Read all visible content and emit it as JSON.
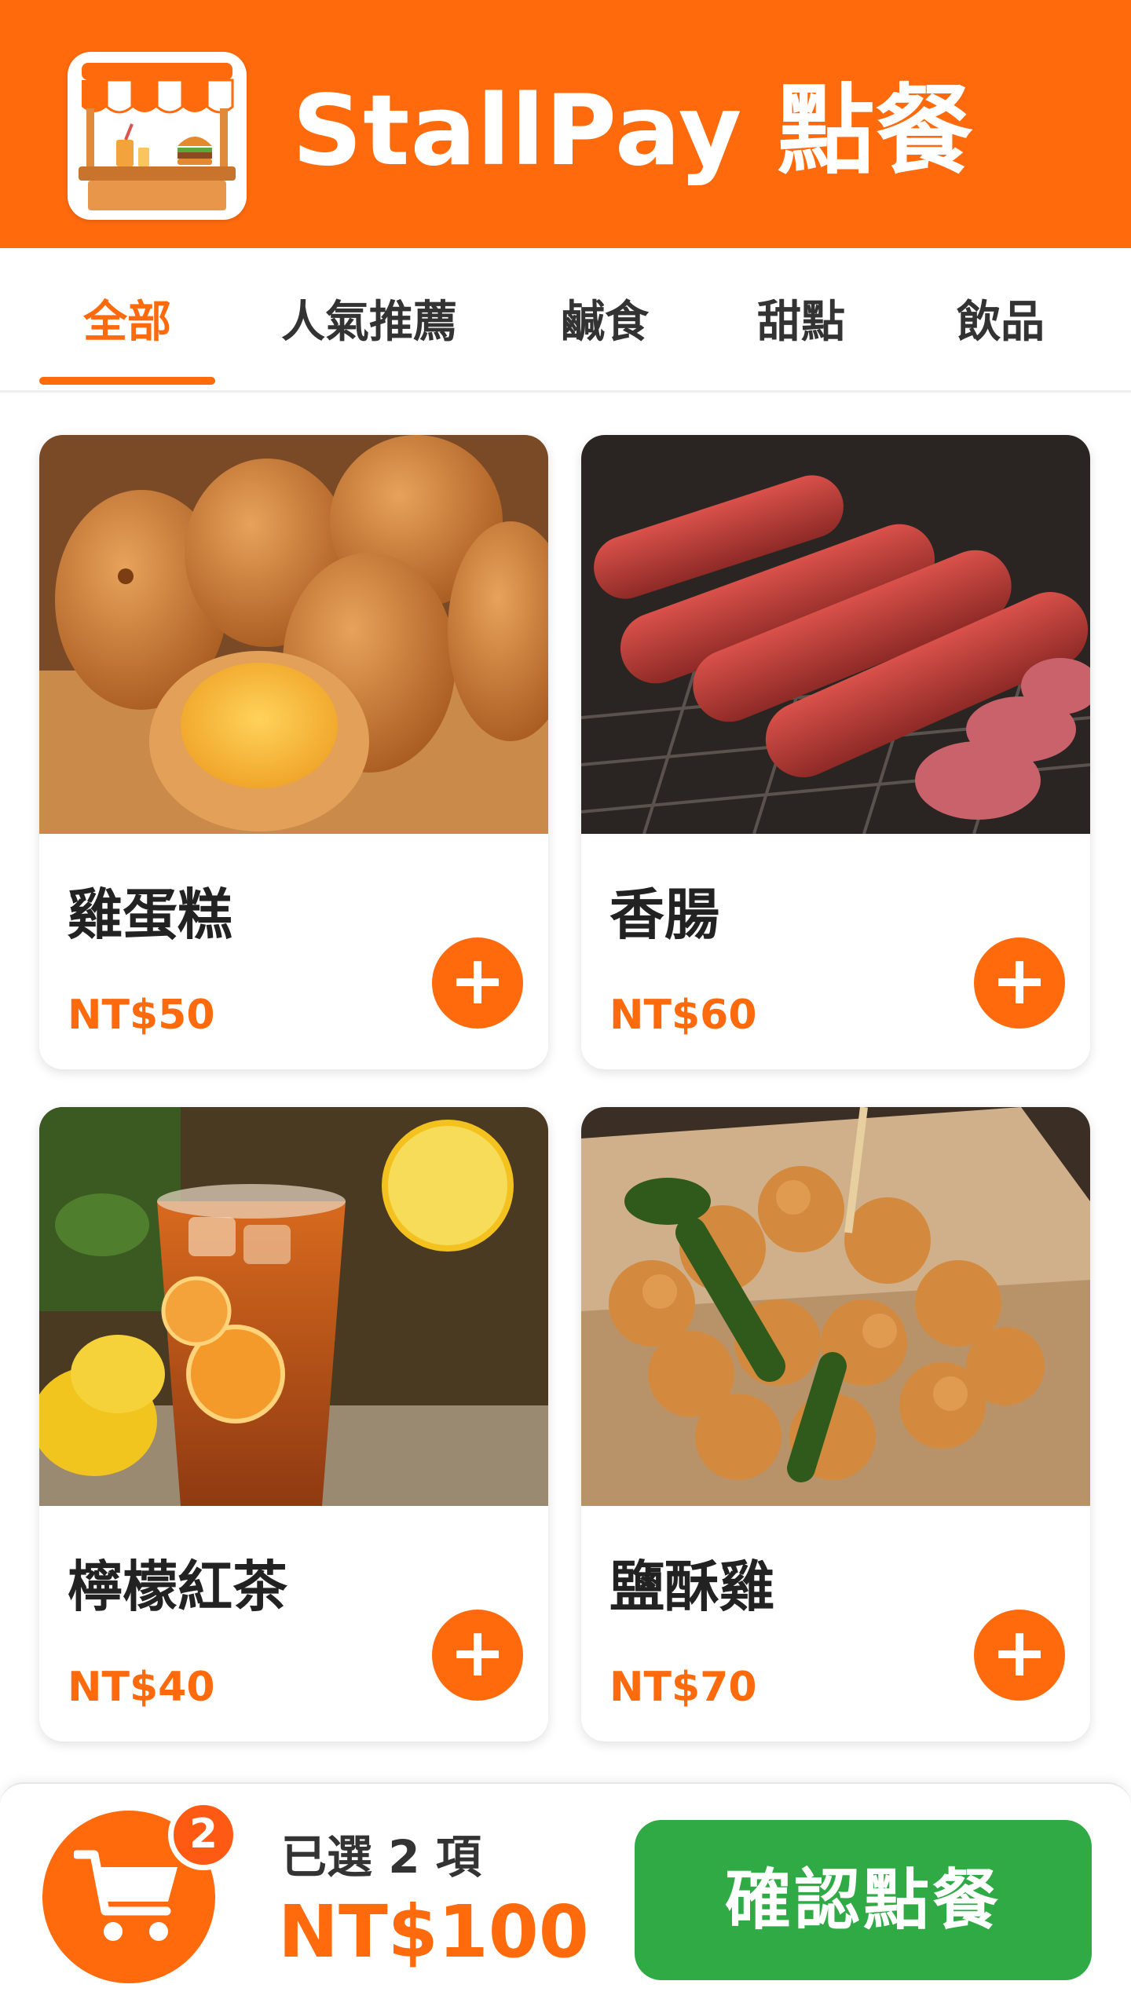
{
  "app": {
    "title": "StallPay 點餐",
    "brand_color": "#ff6a0d",
    "logo_icon": "food-stall-icon"
  },
  "tabs": [
    {
      "label": "全部",
      "active": true
    },
    {
      "label": "人氣推薦",
      "active": false
    },
    {
      "label": "鹹食",
      "active": false
    },
    {
      "label": "甜點",
      "active": false
    },
    {
      "label": "飲品",
      "active": false
    }
  ],
  "menu": {
    "items": [
      {
        "name": "雞蛋糕",
        "price": "NT$50",
        "image": "egg-cake-photo"
      },
      {
        "name": "香腸",
        "price": "NT$60",
        "image": "grilled-sausage-photo"
      },
      {
        "name": "檸檬紅茶",
        "price": "NT$40",
        "image": "lemon-black-tea-photo"
      },
      {
        "name": "鹽酥雞",
        "price": "NT$70",
        "image": "popcorn-chicken-photo"
      }
    ],
    "add_label": "+"
  },
  "cart": {
    "badge_count": "2",
    "selected_text": "已選 2 項",
    "total": "NT$100",
    "confirm_label": "確認點餐",
    "confirm_color": "#2faa45",
    "icon": "shopping-cart-icon"
  }
}
